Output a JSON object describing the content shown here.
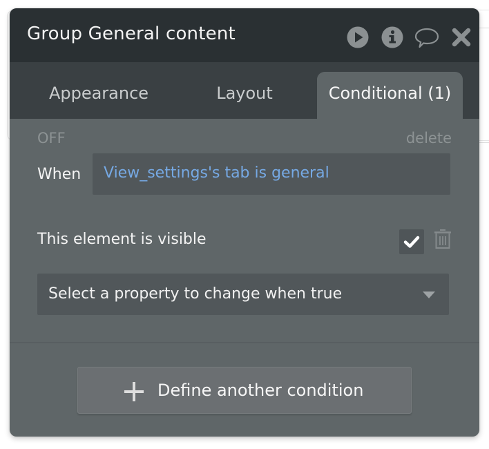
{
  "window": {
    "title": "Group General content",
    "icons": [
      {
        "name": "play-icon",
        "label": "Preview"
      },
      {
        "name": "info-icon",
        "label": "Info"
      },
      {
        "name": "comment-icon",
        "label": "Comments"
      },
      {
        "name": "close-icon",
        "label": "Close"
      }
    ]
  },
  "tabs": [
    {
      "label": "Appearance",
      "active": false
    },
    {
      "label": "Layout",
      "active": false
    },
    {
      "label": "Conditional (1)",
      "active": true
    }
  ],
  "condition": {
    "status": "OFF",
    "delete_label": "delete",
    "when_label": "When",
    "when_expression": "View_settings's tab is general",
    "property_label": "This element is visible",
    "property_checked": true,
    "select_placeholder": "Select a property to change when true"
  },
  "actions": {
    "define_another_label": "Define another condition"
  },
  "colors": {
    "header_bg": "#2a3033",
    "tabbar_bg": "#3a4043",
    "panel_bg": "#5f6668",
    "field_bg": "#51575a",
    "expression_text": "#76a9e4"
  }
}
